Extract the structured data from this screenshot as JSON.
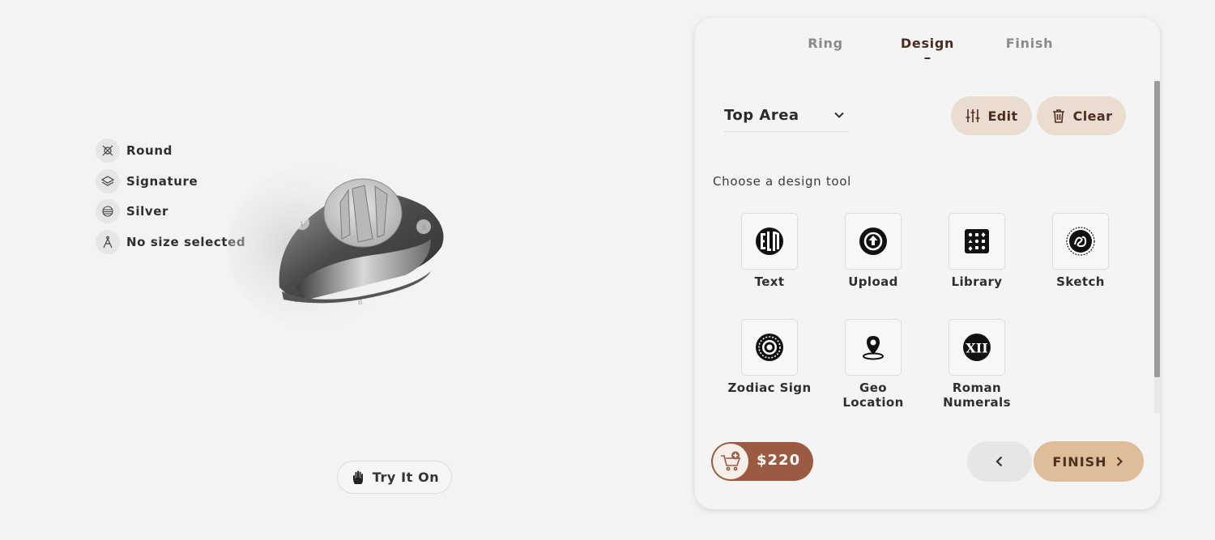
{
  "specs": [
    {
      "icon": "round-shape-icon",
      "label": "Round"
    },
    {
      "icon": "layers-icon",
      "label": "Signature"
    },
    {
      "icon": "metal-icon",
      "label": "Silver"
    },
    {
      "icon": "compass-icon",
      "label": "No size selected"
    }
  ],
  "ring_preview": {
    "engraving": "LAM",
    "markers": [
      "L",
      "R",
      "B"
    ]
  },
  "try_on": {
    "label": "Try It On",
    "icon": "hand-icon"
  },
  "panel": {
    "tabs": [
      {
        "label": "Ring",
        "active": false
      },
      {
        "label": "Design",
        "active": true
      },
      {
        "label": "Finish",
        "active": false
      }
    ],
    "area_select": {
      "value": "Top Area"
    },
    "edit_label": "Edit",
    "clear_label": "Clear",
    "choose_label": "Choose a design tool",
    "tools": [
      {
        "label": "Text",
        "icon": "text-monogram-icon"
      },
      {
        "label": "Upload",
        "icon": "upload-icon"
      },
      {
        "label": "Library",
        "icon": "library-icon"
      },
      {
        "label": "Sketch",
        "icon": "sketch-icon"
      },
      {
        "label": "Zodiac Sign",
        "icon": "zodiac-icon"
      },
      {
        "label": "Geo Location",
        "icon": "location-pin-icon"
      },
      {
        "label": "Roman Numerals",
        "icon": "roman-numerals-icon"
      }
    ],
    "price": "$220",
    "finish_label": "FINISH"
  },
  "colors": {
    "accent_brown": "#9c5a43",
    "accent_tan": "#e0bd99",
    "tab_active": "#4a2d20"
  }
}
